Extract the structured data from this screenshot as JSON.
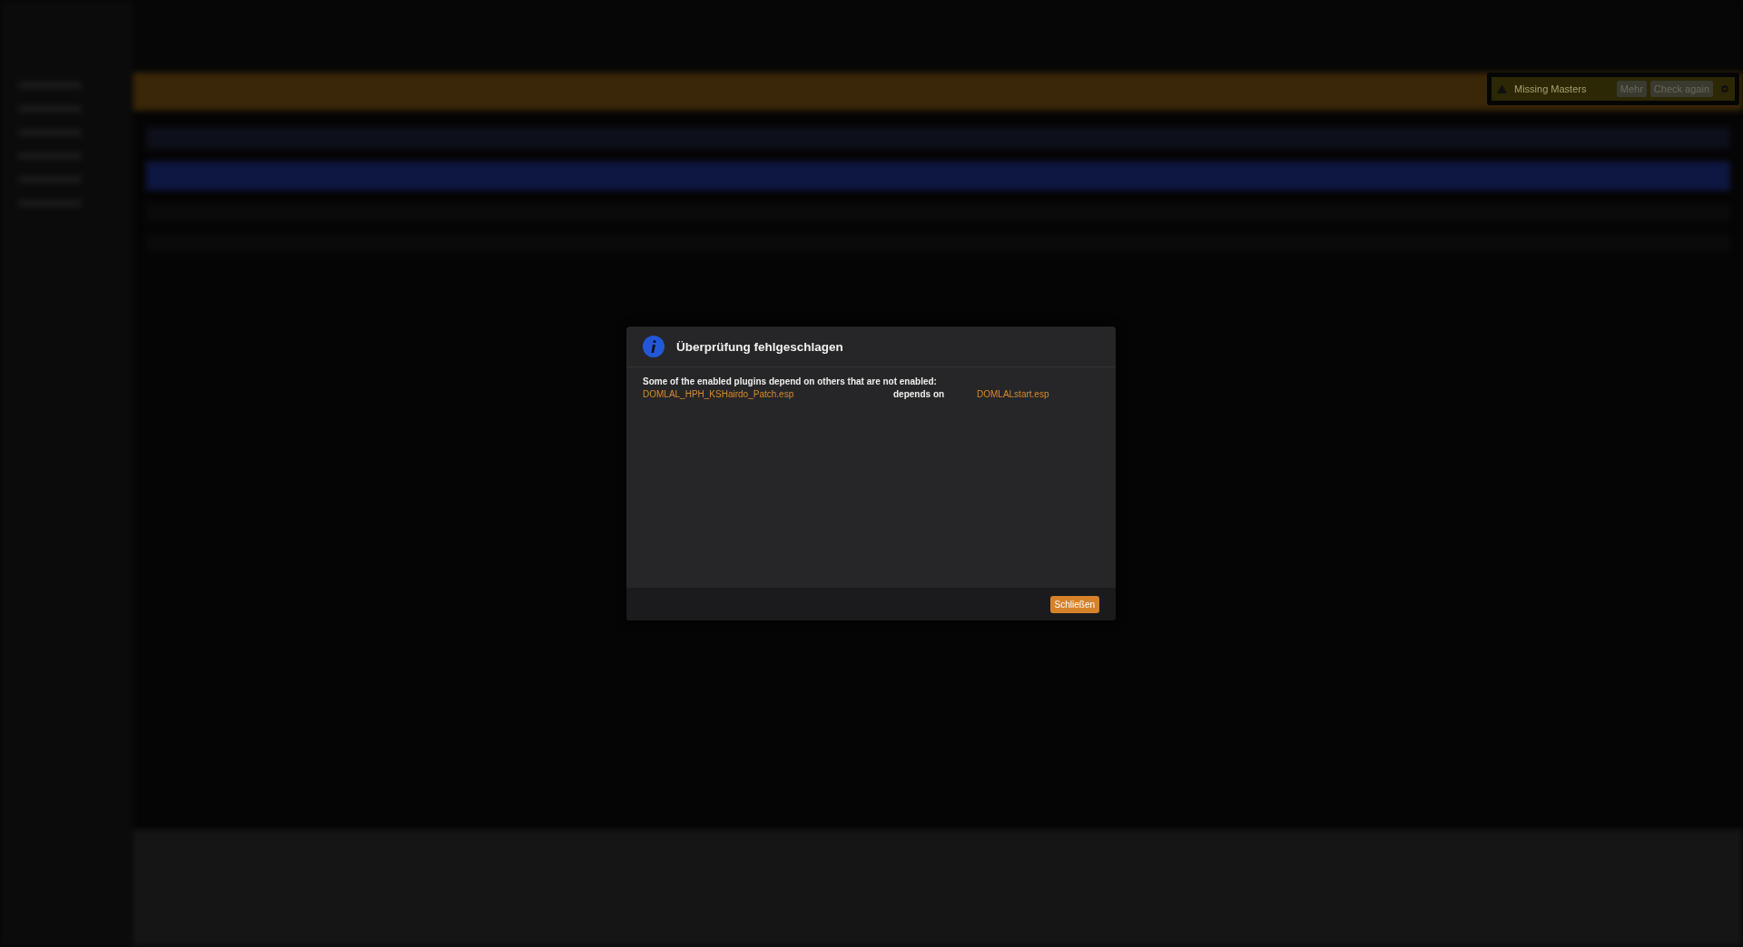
{
  "notification": {
    "title": "Missing Masters",
    "buttons": [
      "Mehr",
      "Check again"
    ]
  },
  "dialog": {
    "title": "Überprüfung fehlgeschlagen",
    "message": "Some of the enabled plugins depend on others that are not enabled:",
    "dependencies": [
      {
        "plugin": "DOMLAL_HPH_KSHairdo_Patch.esp",
        "relation": "depends on",
        "master": "DOMLALstart.esp"
      }
    ],
    "buttons": [
      "Schließen"
    ]
  }
}
